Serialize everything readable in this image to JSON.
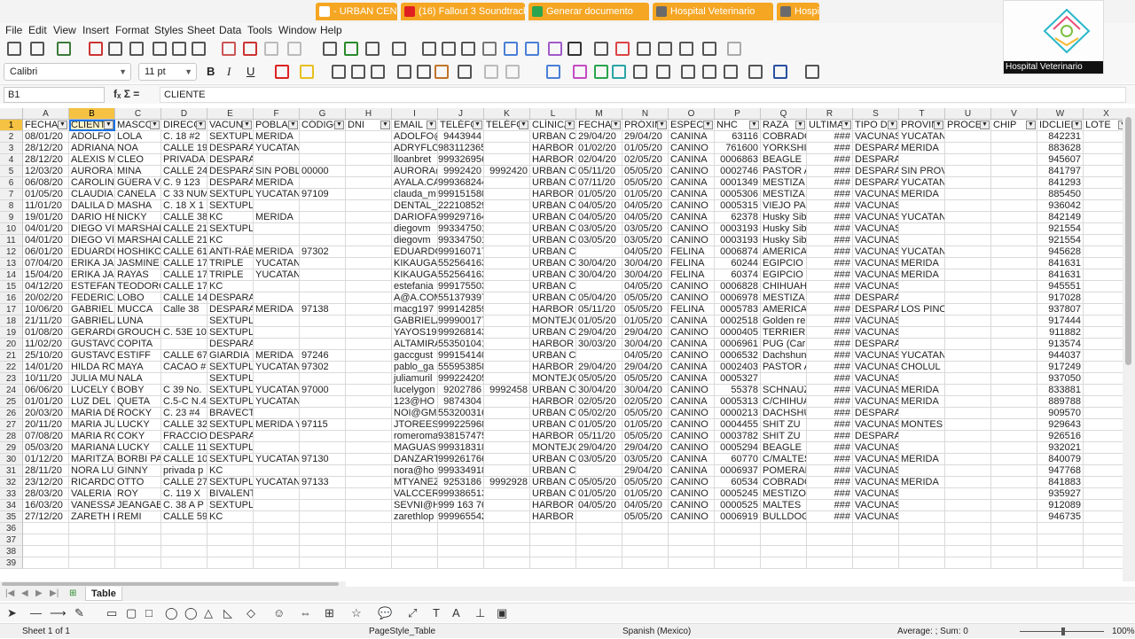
{
  "browser_tabs": [
    {
      "label": "- URBAN CENTER",
      "bg": "#f5a623",
      "fav": "#fff"
    },
    {
      "label": "(16) Fallout 3 Soundtrack",
      "bg": "#f5a623",
      "fav": "#e02020"
    },
    {
      "label": "Generar documento",
      "bg": "#f5a623",
      "fav": "#2aa44f"
    },
    {
      "label": "Hospital Veterinario",
      "bg": "#f5a623",
      "fav": "#6a6a6a"
    },
    {
      "label": "Hospi",
      "bg": "#f5a623",
      "fav": "#6a6a6a"
    }
  ],
  "menu": [
    "File",
    "Edit",
    "View",
    "Insert",
    "Format",
    "Styles",
    "Sheet",
    "Data",
    "Tools",
    "Window",
    "Help"
  ],
  "toolbar": {
    "font_name": "Calibri",
    "font_size": "11 pt",
    "bold": "B",
    "italic": "I",
    "underline": "U"
  },
  "webcam": {
    "caption": "Hospital Veterinario"
  },
  "formula_bar": {
    "cell_ref": "B1",
    "fx_icons": "fₓ  Σ  =",
    "content": "CLIENTE"
  },
  "columns": [
    "A",
    "B",
    "C",
    "D",
    "E",
    "F",
    "G",
    "H",
    "I",
    "J",
    "K",
    "L",
    "M",
    "N",
    "O",
    "P",
    "Q",
    "R",
    "S",
    "T",
    "U",
    "V",
    "W",
    "X"
  ],
  "selected_column": "B",
  "rows": [
    [
      "FECHA",
      "CLIENTE",
      "MASCO",
      "DIRECC",
      "VACUNA",
      "POBLAC",
      "CÓDIGO",
      "DNI",
      "EMAIL",
      "TELÉFO",
      "TELÉFO",
      "CLÍNICA",
      "FECHA",
      "PRÓXIM",
      "ESPECIE",
      "NHC",
      "RAZA",
      "ULTIMA",
      "TIPO DE",
      "PROVIN",
      "PROCED",
      "CHIP",
      "IDCLIEN",
      "LOTE"
    ],
    [
      "08/01/20",
      "ADOLFO",
      "LOLA",
      "C. 18 #2",
      "SEXTUPLE",
      "MERIDA",
      "",
      "",
      "ADOLFO@",
      "9443944",
      "",
      "URBAN C",
      "29/04/20",
      "29/04/20",
      "CANINA",
      "63116",
      "COBRADO",
      "###",
      "VACUNAS",
      "YUCATAN",
      "",
      "",
      "842231",
      ""
    ],
    [
      "28/12/20",
      "ADRIANA",
      "NOA",
      "CALLE 19",
      "DESPARA",
      "YUCATAN",
      "",
      "",
      "ADRYFLO",
      "9831123650",
      "",
      "HARBOR",
      "01/02/20",
      "01/05/20",
      "CANINO",
      "761600",
      "YORKSHI",
      "###",
      "DESPARA",
      "MERIDA",
      "",
      "",
      "883628",
      ""
    ],
    [
      "28/12/20",
      "ALEXIS M",
      "CLEO",
      "PRIVADA",
      "DESPARASITACION",
      "",
      "",
      "",
      "lloanbret",
      "9993269569",
      "",
      "HARBOR",
      "02/04/20",
      "02/05/20",
      "CANINA",
      "0006863",
      "BEAGLE",
      "###",
      "DESPARASITACIONES",
      "",
      "",
      "",
      "945607",
      ""
    ],
    [
      "12/03/20",
      "AURORA",
      "MINA",
      "CALLE 24",
      "DESPARA",
      "SIN POBL",
      "00000",
      "",
      "AURORA@",
      "9992420",
      "9992420",
      "URBAN C",
      "05/11/20",
      "05/05/20",
      "CANINO",
      "0002746",
      "PASTOR A",
      "###",
      "DESPARA",
      "SIN PROVINCIA",
      "",
      "",
      "841797",
      ""
    ],
    [
      "06/08/20",
      "CAROLINA",
      "GÜERA V",
      "C. 9 123",
      "DESPARA",
      "MERIDA",
      "",
      "",
      "AYALA.CA",
      "9993682445",
      "",
      "URBAN C",
      "07/11/20",
      "05/05/20",
      "CANINA",
      "0001349",
      "MESTIZA",
      "###",
      "DESPARA",
      "YUCATAN",
      "",
      "",
      "841293",
      ""
    ],
    [
      "01/05/20",
      "CLAUDIA",
      "CANELA",
      "C 33 NUM",
      "SEXTUPLE",
      "YUCATAN",
      "97109",
      "",
      "clauda_m",
      "9991515804",
      "",
      "HARBOR",
      "01/05/20",
      "01/05/20",
      "CANINA",
      "0005306",
      "MESTIZA",
      "###",
      "VACUNAS",
      "MERIDA",
      "",
      "",
      "885450",
      ""
    ],
    [
      "11/01/20",
      "DALILA D",
      "MASHA",
      "C. 18 X 1",
      "SEXTUPLE (DHPPI+RL)",
      "",
      "",
      "",
      "DENTAL_",
      "2221085290",
      "",
      "URBAN C",
      "04/05/20",
      "04/05/20",
      "CANINO",
      "0005315",
      "VIEJO PAS",
      "###",
      "VACUNAS",
      "",
      "",
      "",
      "936042",
      ""
    ],
    [
      "19/01/20",
      "DARIO HE",
      "NICKY",
      "CALLE 38",
      "KC",
      "MERIDA",
      "",
      "",
      "DARIOFA",
      "9992971643",
      "",
      "URBAN C",
      "04/05/20",
      "04/05/20",
      "CANINA",
      "62378",
      "Husky Sib",
      "###",
      "VACUNAS",
      "YUCATAN",
      "",
      "",
      "842149",
      ""
    ],
    [
      "04/01/20",
      "DIEGO VI",
      "MARSHAL",
      "CALLE 21",
      "SEXTUPLE (DHPPI+RL)",
      "",
      "",
      "",
      "diegovm",
      "9933475018",
      "",
      "URBAN C",
      "03/05/20",
      "03/05/20",
      "CANINO",
      "0003193",
      "Husky Sib",
      "###",
      "VACUNAS",
      "",
      "",
      "",
      "921554",
      ""
    ],
    [
      "04/01/20",
      "DIEGO VI",
      "MARSHAL",
      "CALLE 21",
      "KC",
      "",
      "",
      "",
      "diegovm",
      "9933475018",
      "",
      "URBAN C",
      "03/05/20",
      "03/05/20",
      "CANINO",
      "0003193",
      "Husky Sib",
      "###",
      "VACUNAS",
      "",
      "",
      "",
      "921554",
      ""
    ],
    [
      "06/01/20",
      "EDUARDO",
      "HOSHIKO",
      "CALLE 61",
      "ANTI-RÁB",
      "MERIDA",
      "97302",
      "",
      "EDUARDO",
      "9991607173",
      "",
      "URBAN CENTER",
      "",
      "04/05/20",
      "FELINA",
      "0006874",
      "AMERICAN",
      "###",
      "VACUNAS",
      "YUCATAN",
      "",
      "",
      "945628",
      ""
    ],
    [
      "07/04/20",
      "ERIKA JAS",
      "JASMINE",
      "CALLE 17",
      "TRIPLE",
      "YUCATAN",
      "",
      "",
      "KIKAUGA",
      "5525641630",
      "",
      "URBAN C",
      "30/04/20",
      "30/04/20",
      "FELINA",
      "60244",
      "EGIPCIO",
      "###",
      "VACUNAS",
      "MERIDA",
      "",
      "",
      "841631",
      ""
    ],
    [
      "15/04/20",
      "ERIKA JAS",
      "RAYAS",
      "CALLE 17",
      "TRIPLE",
      "YUCATAN",
      "",
      "",
      "KIKAUGA",
      "5525641630",
      "",
      "URBAN C",
      "30/04/20",
      "30/04/20",
      "FELINA",
      "60374",
      "EGIPCIO",
      "###",
      "VACUNAS",
      "MERIDA",
      "",
      "",
      "841631",
      ""
    ],
    [
      "04/12/20",
      "ESTEFANI",
      "TEODORO",
      "CALLE 17",
      "KC",
      "",
      "",
      "",
      "estefania",
      "9991755039",
      "",
      "URBAN CENTER",
      "",
      "04/05/20",
      "CANINO",
      "0006828",
      "CHIHUAH",
      "###",
      "VACUNAS",
      "",
      "",
      "",
      "945551",
      ""
    ],
    [
      "20/02/20",
      "FEDERICA",
      "LOBO",
      "CALLE 14",
      "DESPARASITACION",
      "",
      "",
      "",
      "A@A.COM",
      "5513793972",
      "",
      "URBAN C",
      "05/04/20",
      "05/05/20",
      "CANINO",
      "0006978",
      "MESTIZA",
      "###",
      "DESPARASITACIONES",
      "",
      "",
      "",
      "917028",
      ""
    ],
    [
      "10/06/20",
      "GABRIEL",
      "MUCCA",
      "Calle 38",
      "DESPARA",
      "MERIDA",
      "97138",
      "",
      "macg197",
      "9991428598",
      "",
      "HARBOR",
      "05/11/20",
      "05/05/20",
      "FELINA",
      "0005783",
      "AMERICAN",
      "###",
      "DESPARA",
      "LOS PINOS",
      "",
      "",
      "937807",
      ""
    ],
    [
      "21/11/20",
      "GABRIELA",
      "LUNA",
      "",
      "SEXTUPLE (DHPPI+RL)",
      "",
      "",
      "",
      "GABRIELA",
      "9999001773",
      "",
      "MONTEJO",
      "01/05/20",
      "01/05/20",
      "CANINA",
      "0002518",
      "Golden re",
      "###",
      "VACUNAS",
      "",
      "",
      "",
      "917444",
      ""
    ],
    [
      "01/08/20",
      "GERARDO",
      "GROUCHO",
      "C. 53E 10",
      "SEXTUPLE (DHPPI+RL)",
      "",
      "",
      "",
      "YAYOS19",
      "9992681430",
      "",
      "URBAN C",
      "29/04/20",
      "29/04/20",
      "CANINO",
      "0000405",
      "TERRIER",
      "###",
      "VACUNAS",
      "",
      "",
      "",
      "911882",
      ""
    ],
    [
      "11/02/20",
      "GUSTAVO",
      "COPITA",
      "",
      "DESPARASITACION",
      "",
      "",
      "",
      "ALTAMIRA",
      "5535010418",
      "",
      "HARBOR",
      "30/03/20",
      "30/04/20",
      "CANINA",
      "0006961",
      "PUG (Carl",
      "###",
      "DESPARASITACIONES",
      "",
      "",
      "",
      "913574",
      ""
    ],
    [
      "25/10/20",
      "GUSTAVO",
      "ESTIFF",
      "CALLE 67",
      "GIARDIA",
      "MERIDA",
      "97246",
      "",
      "gaccgust",
      "9991541404",
      "",
      "URBAN CENTER",
      "",
      "04/05/20",
      "CANINO",
      "0006532",
      "Dachshun",
      "###",
      "VACUNAS",
      "YUCATAN",
      "",
      "",
      "944037",
      ""
    ],
    [
      "14/01/20",
      "HILDA RO",
      "MAYA",
      "CACAO #",
      "SEXTUPLE",
      "YUCATAN",
      "97302",
      "",
      "pablo_ga",
      "5559538588",
      "",
      "HARBOR",
      "29/04/20",
      "29/04/20",
      "CANINA",
      "0002403",
      "PASTOR A",
      "###",
      "VACUNAS",
      "CHOLUL",
      "",
      "",
      "917249",
      ""
    ],
    [
      "10/11/20",
      "JULIA MU",
      "NALA",
      "",
      "SEXTUPLE (DHPPI+RL)",
      "",
      "",
      "",
      "juliamuril",
      "9992242059",
      "",
      "MONTEJO",
      "05/05/20",
      "05/05/20",
      "CANINA",
      "0005327",
      "",
      "###",
      "VACUNAS",
      "",
      "",
      "",
      "937050",
      ""
    ],
    [
      "06/06/20",
      "LUCELY G",
      "BOBY",
      "C 39 No.",
      "SEXTUPLE",
      "YUCATAN",
      "97000",
      "",
      "lucelygon",
      "9202786",
      "9992458",
      "URBAN C",
      "30/04/20",
      "30/04/20",
      "CANINO",
      "55378",
      "SCHNAUZ",
      "###",
      "VACUNAS",
      "MERIDA",
      "",
      "",
      "833881",
      ""
    ],
    [
      "01/01/20",
      "LUZ DEL",
      "QUETA",
      "C.5-C N.4",
      "SEXTUPLE",
      "YUCATAN",
      "",
      "",
      "123@HO",
      "9874304",
      "",
      "HARBOR",
      "02/05/20",
      "02/05/20",
      "CANINA",
      "0005313",
      "C/CHIHUA",
      "###",
      "VACUNAS",
      "MERIDA",
      "",
      "",
      "889788",
      ""
    ],
    [
      "20/03/20",
      "MARIA DE",
      "ROCKY",
      "C. 23 #4",
      "BRAVECTO",
      "",
      "",
      "",
      "NOI@GMA",
      "5532003163",
      "",
      "URBAN C",
      "05/02/20",
      "05/05/20",
      "CANINO",
      "0000213",
      "DACHSHU",
      "###",
      "DESPARASITACIONES",
      "",
      "",
      "",
      "909570",
      ""
    ],
    [
      "20/11/20",
      "MARIA JU",
      "LUCKY",
      "CALLE 32",
      "SEXTUPLE",
      "MERIDA Y",
      "97115",
      "",
      "JTOREES",
      "9992259688",
      "",
      "URBAN C",
      "01/05/20",
      "01/05/20",
      "CANINO",
      "0004455",
      "SHIT ZU",
      "###",
      "VACUNAS",
      "MONTES DE AME",
      "",
      "",
      "929643",
      ""
    ],
    [
      "07/08/20",
      "MARIA RO",
      "COKY",
      "FRACCION",
      "DESPARASITACION",
      "",
      "",
      "",
      "romeroma",
      "9381574752",
      "",
      "HARBOR",
      "05/11/20",
      "05/05/20",
      "CANINO",
      "0003782",
      "SHIT ZU",
      "###",
      "DESPARASITACIONES",
      "",
      "",
      "",
      "926516",
      ""
    ],
    [
      "05/03/20",
      "MARIANA",
      "LUCKY",
      "CALLE 11",
      "SEXTUPLE (DHPPI+RL)",
      "",
      "",
      "",
      "MAGUAS",
      "9993183185",
      "",
      "MONTEJO",
      "29/04/20",
      "29/04/20",
      "CANINO",
      "0005294",
      "BEAGLE",
      "###",
      "VACUNAS",
      "",
      "",
      "",
      "932021",
      ""
    ],
    [
      "01/12/20",
      "MARITZA",
      "BORBI PA",
      "CALLE 10",
      "SEXTUPLE",
      "YUCATAN",
      "97130",
      "",
      "DANZART",
      "9992617668",
      "",
      "URBAN C",
      "03/05/20",
      "03/05/20",
      "CANINA",
      "60770",
      "C/MALTES",
      "###",
      "VACUNAS",
      "MERIDA",
      "",
      "",
      "840079",
      ""
    ],
    [
      "28/11/20",
      "NORA LU",
      "GINNY",
      "privada p",
      "KC",
      "",
      "",
      "",
      "nora@ho",
      "9993349180",
      "",
      "URBAN CENTER",
      "",
      "29/04/20",
      "CANINA",
      "0006937",
      "POMERAN",
      "###",
      "VACUNAS",
      "",
      "",
      "",
      "947768",
      ""
    ],
    [
      "23/12/20",
      "RICARDO",
      "OTTO",
      "CALLE 27",
      "SEXTUPLE",
      "YUCATAN",
      "97133",
      "",
      "MTYANEZ",
      "9253186",
      "9992928",
      "URBAN C",
      "05/05/20",
      "05/05/20",
      "CANINO",
      "60534",
      "COBRADO",
      "###",
      "VACUNAS",
      "MERIDA",
      "",
      "",
      "841883",
      ""
    ],
    [
      "28/03/20",
      "VALERIA",
      "ROY",
      "C. 119 X",
      "BIVALENTE (Bordetella y Parainfluenza)",
      "",
      "",
      "",
      "VALCCER",
      "9993865133",
      "",
      "URBAN C",
      "01/05/20",
      "01/05/20",
      "CANINO",
      "0005245",
      "MESTIZO",
      "###",
      "VACUNAS",
      "",
      "",
      "",
      "935927",
      ""
    ],
    [
      "16/03/20",
      "VANESSA",
      "JEANGABI",
      "C. 38 A P",
      "SEXTUPLE (DHPPI+RL)",
      "",
      "",
      "",
      "SEVNI@H",
      "999 163 7636",
      "",
      "HARBOR",
      "04/05/20",
      "04/05/20",
      "CANINO",
      "0000525",
      "MALTES",
      "###",
      "VACUNAS",
      "",
      "",
      "",
      "912089",
      ""
    ],
    [
      "27/12/20",
      "ZARETH L",
      "REMI",
      "CALLE 59",
      "KC",
      "",
      "",
      "",
      "zarethlop",
      "9999655421",
      "",
      "HARBOR",
      "",
      "05/05/20",
      "CANINO",
      "0006919",
      "BULLDOG",
      "###",
      "VACUNAS",
      "",
      "",
      "",
      "946735",
      ""
    ]
  ],
  "empty_rows": 4,
  "sheet_tab": "Table",
  "status": {
    "sheet": "Sheet 1 of 1",
    "page_style": "PageStyle_Table",
    "language": "Spanish (Mexico)",
    "sum": "Average: ; Sum: 0",
    "zoom": "100%"
  }
}
